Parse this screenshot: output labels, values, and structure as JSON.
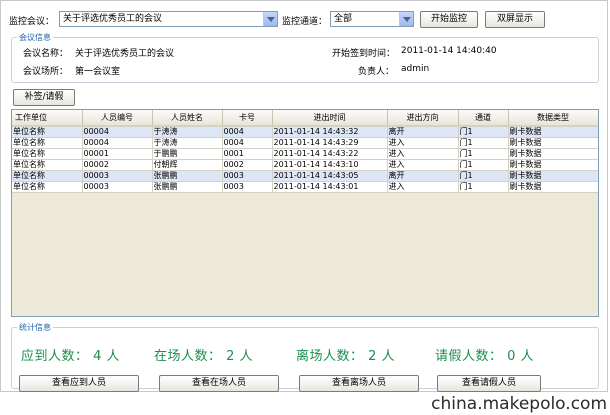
{
  "toolbar": {
    "meeting_label": "监控会议：",
    "meeting_value": "关于评选优秀员工的会议",
    "channel_label": "监控通道：",
    "channel_value": "全部",
    "start_button": "开始监控",
    "dual_screen_button": "双屏显示"
  },
  "meeting_info": {
    "group_title": "会议信息",
    "name_label": "会议名称：",
    "name_value": "关于评选优秀员工的会议",
    "location_label": "会议场所：",
    "location_value": "第一会议室",
    "start_time_label": "开始签到时间：",
    "start_time_value": "2011-01-14 14:40:40",
    "owner_label": "负责人：",
    "owner_value": "admin"
  },
  "supplement_button": "补签/请假",
  "table": {
    "columns": [
      "工作单位",
      "人员编号",
      "人员姓名",
      "卡号",
      "进出时间",
      "进出方向",
      "通道",
      "数据类型"
    ],
    "rows": [
      [
        "单位名称",
        "00004",
        "于涛涛",
        "0004",
        "2011-01-14 14:43:32",
        "离开",
        "门1",
        "刷卡数据"
      ],
      [
        "单位名称",
        "00004",
        "于涛涛",
        "0004",
        "2011-01-14 14:43:29",
        "进入",
        "门1",
        "刷卡数据"
      ],
      [
        "单位名称",
        "00001",
        "于鹏鹏",
        "0001",
        "2011-01-14 14:43:22",
        "进入",
        "门1",
        "刷卡数据"
      ],
      [
        "单位名称",
        "00002",
        "付朝辉",
        "0002",
        "2011-01-14 14:43:10",
        "进入",
        "门1",
        "刷卡数据"
      ],
      [
        "单位名称",
        "00003",
        "张鹏鹏",
        "0003",
        "2011-01-14 14:43:05",
        "离开",
        "门1",
        "刷卡数据"
      ],
      [
        "单位名称",
        "00003",
        "张鹏鹏",
        "0003",
        "2011-01-14 14:43:01",
        "进入",
        "门1",
        "刷卡数据"
      ]
    ]
  },
  "stats": {
    "group_title": "统计信息",
    "expected": "应到人数： 4 人",
    "present": "在场人数： 2 人",
    "left": "离场人数： 2 人",
    "leave": "请假人数： 0 人",
    "view_expected_button": "查看应到人员",
    "view_present_button": "查看在场人员",
    "view_left_button": "查看离场人员",
    "view_leave_button": "查看请假人员"
  },
  "watermark": "china.makepolo.com",
  "colors": {
    "stat_text": "#1b8f4b",
    "group_title": "#1d5fa8",
    "selected_row": "#dce6f4"
  }
}
